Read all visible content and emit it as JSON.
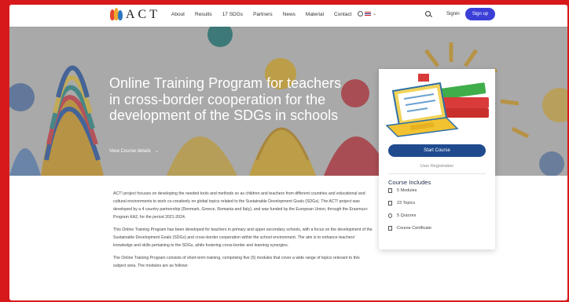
{
  "nav": {
    "logo_text": "ACT",
    "items": [
      "About",
      "Results",
      "17 SDGs",
      "Partners",
      "News",
      "Material",
      "Contact"
    ],
    "login": "Signin",
    "signup": "Sign up"
  },
  "hero": {
    "title": "Online Training Program for teachers in cross-border cooperation for the development of the SDGs in schools",
    "link": "View Course details",
    "chevron": "⌄"
  },
  "card": {
    "start_button": "Start Course",
    "user_registration": "User Registration",
    "includes_title": "Course Includes",
    "includes": [
      {
        "icon": "modules-icon",
        "label": "5 Modules"
      },
      {
        "icon": "topics-icon",
        "label": "23 Topics"
      },
      {
        "icon": "quizzes-icon",
        "label": "5 Quizzes"
      },
      {
        "icon": "certificate-icon",
        "label": "Course Certificate"
      }
    ]
  },
  "content": {
    "p1": "ACT! project focuses on developing the needed tools and methods so as children and teachers from different countries and educational and cultural environments to work co-creatively on global topics related to the Sustainable Development Goals (SDGs). The ACT! project was developed by a 4 country partnership (Denmark, Greece, Romania and Italy), and was funded by the European Union, through the Erasmus+ Program KA2, for the period 2021-2024.",
    "p2": "This Online Training Program has been developed for teachers in primary and upper secondary schools, with a focus on the development of the Sustainable Development Goals (SDGs) and cross-border cooperation within the school environment. The aim is to enhance teachers' knowledge and skills pertaining to the SDGs, while fostering cross-border and learning synergies.",
    "p3": "The Online Training Program consists of short-term training, comprising five (5) modules that cover a wide range of topics relevant to this subject area. The modules are as follows:"
  },
  "colors": {
    "frame_border": "#d7191c",
    "signup_bg": "#3b3fd8",
    "start_btn_bg": "#1f4a8e",
    "title_color": "#1d2b4a"
  }
}
